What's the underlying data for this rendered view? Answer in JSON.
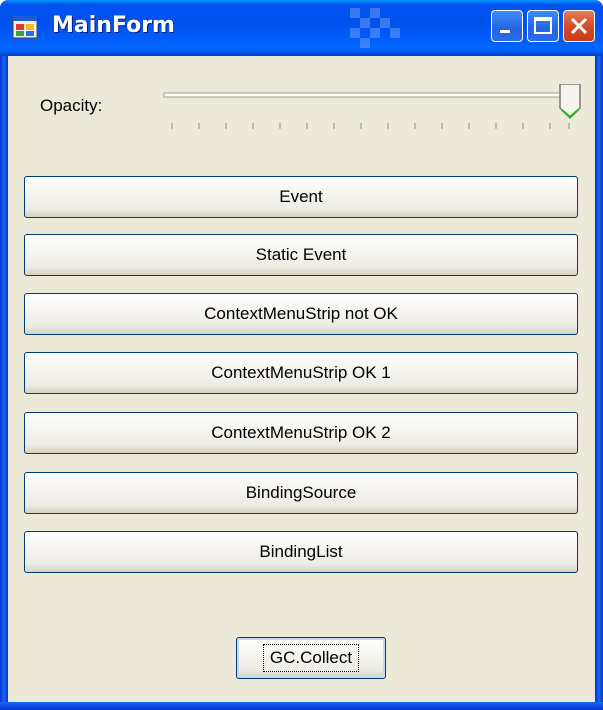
{
  "window": {
    "title": "MainForm",
    "controls": [
      "minimize-icon",
      "maximize-icon",
      "close-icon"
    ]
  },
  "opacity": {
    "label": "Opacity:",
    "value": 1.0
  },
  "buttons": [
    {
      "label": "Event"
    },
    {
      "label": "Static Event"
    },
    {
      "label": "ContextMenuStrip not OK"
    },
    {
      "label": "ContextMenuStrip OK 1"
    },
    {
      "label": "ContextMenuStrip OK 2"
    },
    {
      "label": "BindingSource"
    },
    {
      "label": "BindingList"
    }
  ],
  "gc_button": {
    "label": "GC.Collect"
  },
  "colors": {
    "titlebar": "#0053ee",
    "client_background": "#ece9d8",
    "button_border": "#003c74",
    "close_button": "#d14a27"
  }
}
